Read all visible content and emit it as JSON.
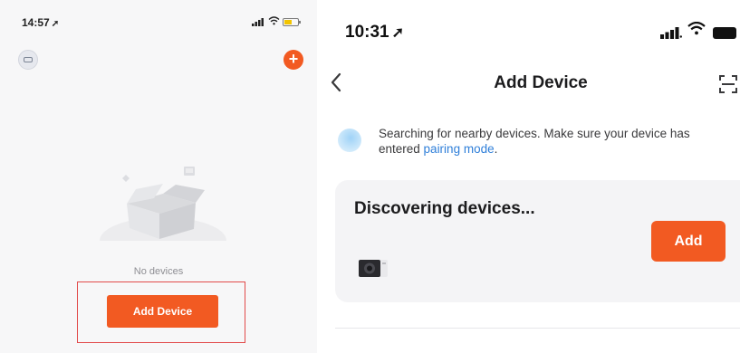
{
  "left_screen": {
    "status_bar": {
      "time": "14:57",
      "arrow": "➚"
    },
    "empty_state_text": "No devices",
    "add_device_label": "Add Device",
    "plus_symbol": "+"
  },
  "right_screen": {
    "status_bar": {
      "time": "10:31",
      "arrow": "➚"
    },
    "back_symbol": "‹",
    "title": "Add Device",
    "search_message_before": "Searching for nearby devices. Make sure your device has entered ",
    "search_message_link": "pairing mode",
    "search_message_after": ".",
    "discover_title": "Discovering devices...",
    "add_label": "Add"
  },
  "icons": {
    "left": [
      "location-arrow-icon",
      "signal-icon",
      "wifi-icon",
      "battery-icon",
      "avatar-icon",
      "plus-icon",
      "empty-box-illustration"
    ],
    "right": [
      "location-arrow-icon",
      "signal-icon",
      "wifi-icon",
      "battery-icon",
      "back-chevron-icon",
      "scan-icon",
      "search-dot-icon",
      "device-thumbnail-icon"
    ]
  },
  "colors": {
    "accent": "#f25a22",
    "link": "#2f7fd9",
    "highlight": "#e24a4a",
    "card_bg": "#f4f4f6",
    "left_bg": "#f7f7f8"
  }
}
